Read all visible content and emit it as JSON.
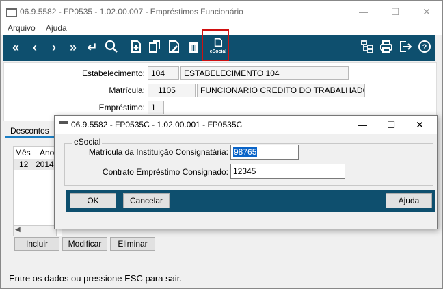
{
  "main_window": {
    "title": "06.9.5582 - FP0535 - 1.02.00.007 - Empréstimos Funcionário",
    "menu": [
      "Arquivo",
      "Ajuda"
    ],
    "toolbar": {
      "esocial_label": "eSocial",
      "icons": [
        "first-icon",
        "prev-icon",
        "next-icon",
        "last-icon",
        "return-icon",
        "search-icon",
        "new-icon",
        "copy-icon",
        "edit-icon",
        "delete-icon",
        "esocial-icon",
        "tree-icon",
        "print-icon",
        "exit-icon",
        "help-icon"
      ]
    },
    "form": {
      "estabelecimento_label": "Estabelecimento:",
      "estabelecimento_code": "104",
      "estabelecimento_name": "ESTABELECIMENTO 104",
      "matricula_label": "Matrícula:",
      "matricula_code": "1105",
      "matricula_name": "FUNCIONARIO CREDITO  DO TRABALHADOR",
      "emprestimo_label": "Empréstimo:",
      "emprestimo_value": "1"
    },
    "tab_label": "Descontos",
    "grid": {
      "headers": [
        "Mês",
        "Ano"
      ],
      "rows": [
        [
          "12",
          "2014"
        ]
      ]
    },
    "buttons": {
      "incluir": "Incluir",
      "modificar": "Modificar",
      "eliminar": "Eliminar"
    },
    "status_text": "Entre os dados ou pressione ESC para sair."
  },
  "dialog": {
    "title": "06.9.5582 - FP0535C - 1.02.00.001 - FP0535C",
    "group_label": "eSocial",
    "matricula_inst_label": "Matrícula da Instituição Consignatária:",
    "matricula_inst_value": "98765",
    "contrato_label": "Contrato Empréstimo Consignado:",
    "contrato_value": "12345",
    "ok_label": "OK",
    "cancelar_label": "Cancelar",
    "ajuda_label": "Ajuda"
  },
  "colors": {
    "toolbar_bg": "#0e4f6e",
    "highlight_border": "#d01010",
    "selection": "#0a64c8",
    "tab_accent": "#1a7ec4"
  }
}
